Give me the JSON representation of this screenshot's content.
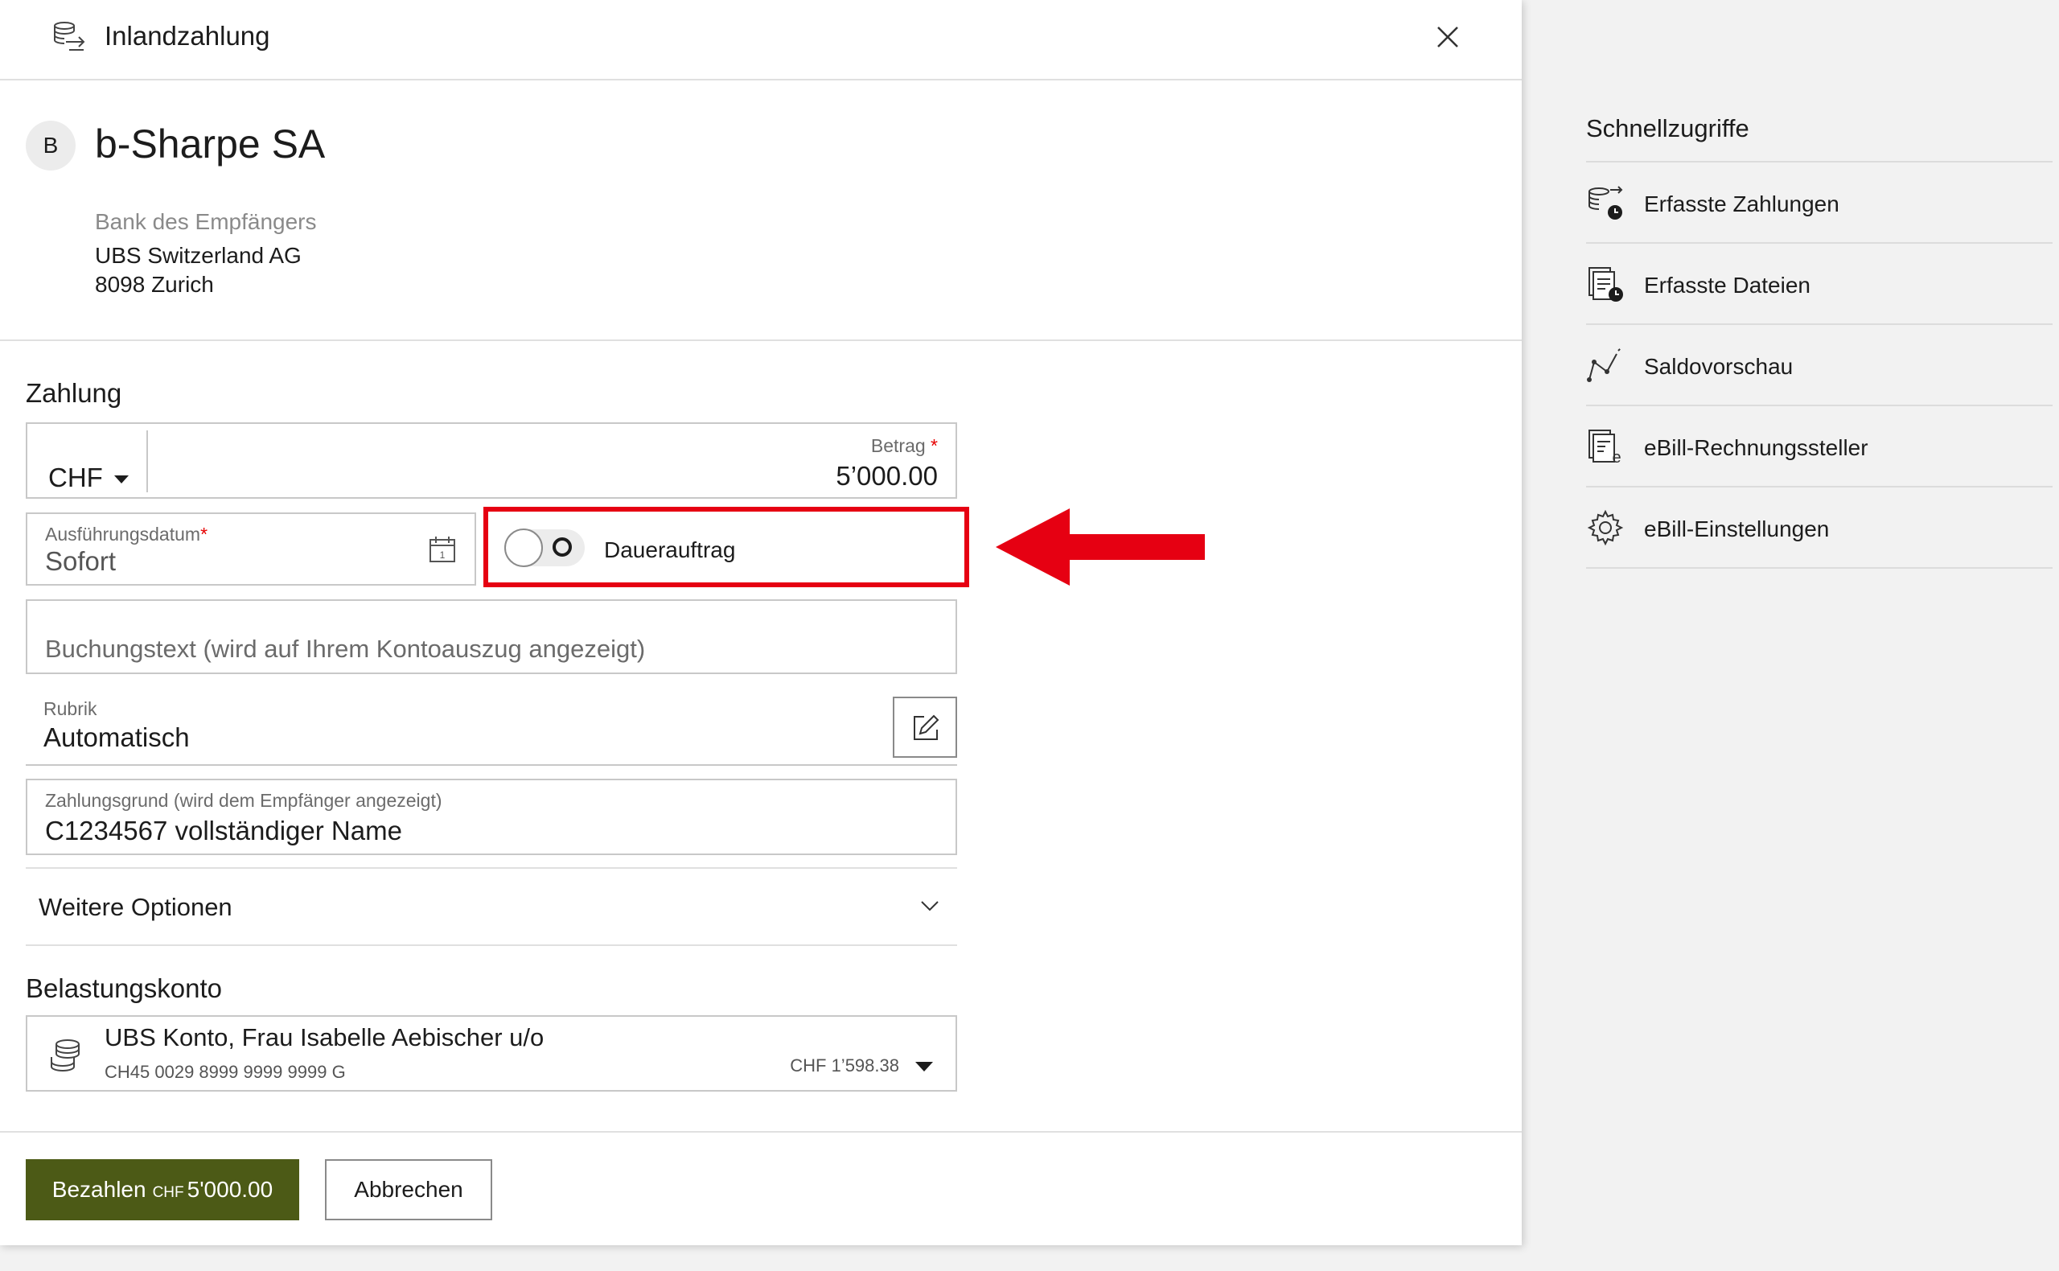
{
  "header": {
    "title": "Inlandzahlung"
  },
  "payee": {
    "initial": "B",
    "name": "b-Sharpe SA",
    "bank_label": "Bank des Empfängers",
    "bank_name": "UBS Switzerland AG",
    "bank_city": "8098 Zurich"
  },
  "payment": {
    "section_title": "Zahlung",
    "currency": "CHF",
    "amount_label": "Betrag",
    "amount_required": "*",
    "amount_value": "5’000.00",
    "date_label": "Ausführungsdatum",
    "date_required": "*",
    "date_value": "Sofort",
    "standing_order_label": "Dauerauftrag",
    "booking_text_placeholder": "Buchungstext (wird auf Ihrem Kontoauszug angezeigt)",
    "category_label": "Rubrik",
    "category_value": "Automatisch",
    "reason_label": "Zahlungsgrund (wird dem Empfänger angezeigt)",
    "reason_value": "C1234567 vollständiger Name",
    "more_options_label": "Weitere Optionen"
  },
  "debit_account": {
    "section_title": "Belastungskonto",
    "name": "UBS Konto, Frau Isabelle Aebischer u/o",
    "iban": "CH45 0029 8999 9999 9999 G",
    "balance": "CHF  1’598.38"
  },
  "footer": {
    "pay_label": "Bezahlen",
    "pay_currency": "CHF",
    "pay_amount": "5'000.00",
    "cancel_label": "Abbrechen"
  },
  "quick_access": {
    "title": "Schnellzugriffe",
    "items": [
      {
        "label": "Erfasste Zahlungen",
        "icon": "payments-clock-icon"
      },
      {
        "label": "Erfasste Dateien",
        "icon": "files-clock-icon"
      },
      {
        "label": "Saldovorschau",
        "icon": "balance-chart-icon"
      },
      {
        "label": "eBill-Rechnungssteller",
        "icon": "ebill-document-icon"
      },
      {
        "label": "eBill-Einstellungen",
        "icon": "gear-icon"
      }
    ]
  },
  "colors": {
    "accent_green": "#4c5a16",
    "highlight_red": "#e60012",
    "required_red": "#e60000"
  }
}
